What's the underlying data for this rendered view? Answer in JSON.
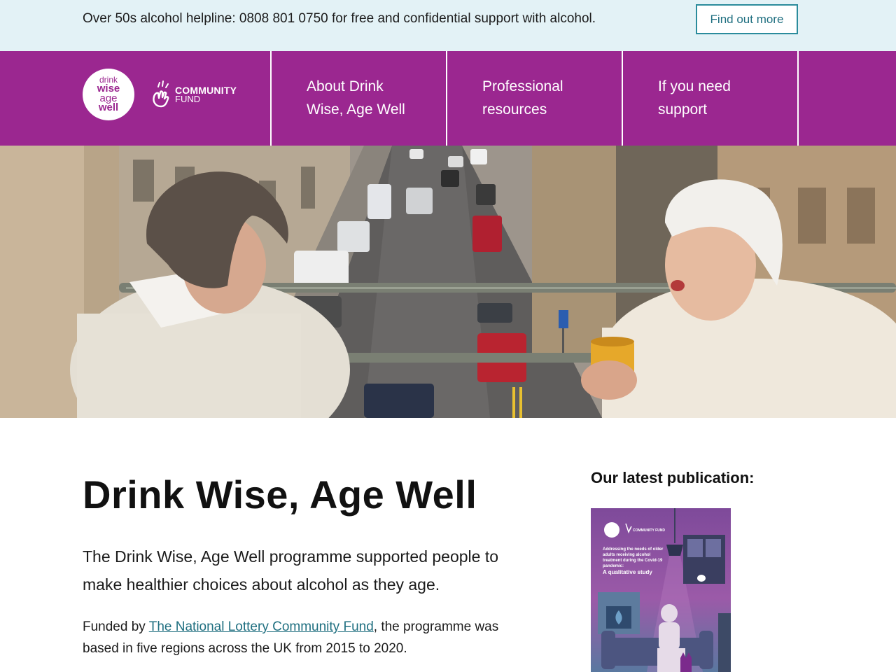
{
  "helpline": {
    "text": "Over 50s alcohol helpline: 0808 801 0750 for free and confidential support with alcohol.",
    "button_label": "Find out more"
  },
  "header": {
    "logo_lines": [
      "drink",
      "wise",
      "age",
      "well"
    ],
    "partner_logo": [
      "COMMUNITY",
      "FUND"
    ],
    "nav": [
      {
        "line1": "About Drink",
        "line2": "Wise, Age Well"
      },
      {
        "line1": "Professional",
        "line2": "resources"
      },
      {
        "line1": "If you need",
        "line2": "support"
      }
    ]
  },
  "main": {
    "title": "Drink Wise, Age Well",
    "intro": "The Drink Wise, Age Well programme supported people to make healthier choices about alcohol as they age.",
    "funded_prefix": "Funded by ",
    "funded_link": "The National Lottery Community Fund",
    "funded_suffix": ", the programme was based in five regions across the UK from 2015 to 2020."
  },
  "sidebar": {
    "heading": "Our latest publication:",
    "cover_title": "Addressing the needs of older adults receiving alcohol treatment during the Covid-19 pandemic:",
    "cover_subtitle": "A qualitative study",
    "cover_logo_text": "COMMUNITY FUND"
  },
  "colors": {
    "brand_purple": "#9b2790",
    "helpline_bg": "#e3f2f6",
    "link_teal": "#1f6f80"
  }
}
